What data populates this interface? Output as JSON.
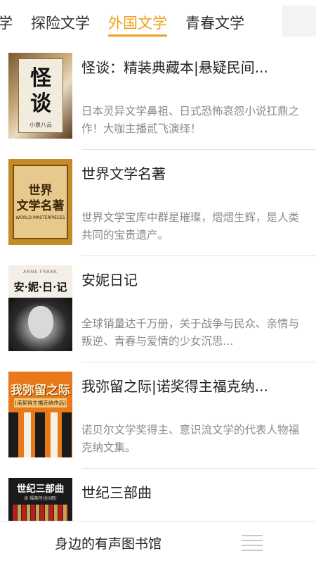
{
  "tabs": {
    "items": [
      {
        "label": "文学"
      },
      {
        "label": "探险文学"
      },
      {
        "label": "外国文学"
      },
      {
        "label": "青春文学"
      }
    ],
    "active_color": "#f2a11d"
  },
  "books": [
    {
      "title": "怪谈：精装典藏本|悬疑民间...",
      "description": "日本灵异文学鼻祖、日式恐怖哀怨小说扛鼎之作！大咖主播贰飞演绎！",
      "cover": {
        "big": "怪谈",
        "sub": "小泉八云"
      }
    },
    {
      "title": "世界文学名著",
      "description": "世界文学宝库中群星璀璨，熠熠生辉，是人类共同的宝贵遗产。",
      "cover": {
        "line1": "世界",
        "line2": "文学名著",
        "sub": "WORLD MASTERPIECES"
      }
    },
    {
      "title": "安妮日记",
      "description": "全球销量达千万册，关于战争与民众、亲情与叛逆、青春与爱情的少女沉思...",
      "cover": {
        "eng": "ANNE FRANK",
        "title": "安·妮·日·记"
      }
    },
    {
      "title": "我弥留之际|诺奖得主福克纳...",
      "description": "诺贝尔文学奖得主、意识流文学的代表人物福克纳文集。",
      "cover": {
        "title": "我弥留之际",
        "sub": "(诺奖得主福克纳作品)"
      }
    },
    {
      "title": "世纪三部曲",
      "description": "",
      "cover": {
        "title": "世纪三部曲",
        "sub": "肯·福莱特(全9册)"
      }
    }
  ],
  "bottom_bar": {
    "label": "身边的有声图书馆",
    "menu_icon": "menu-icon"
  }
}
